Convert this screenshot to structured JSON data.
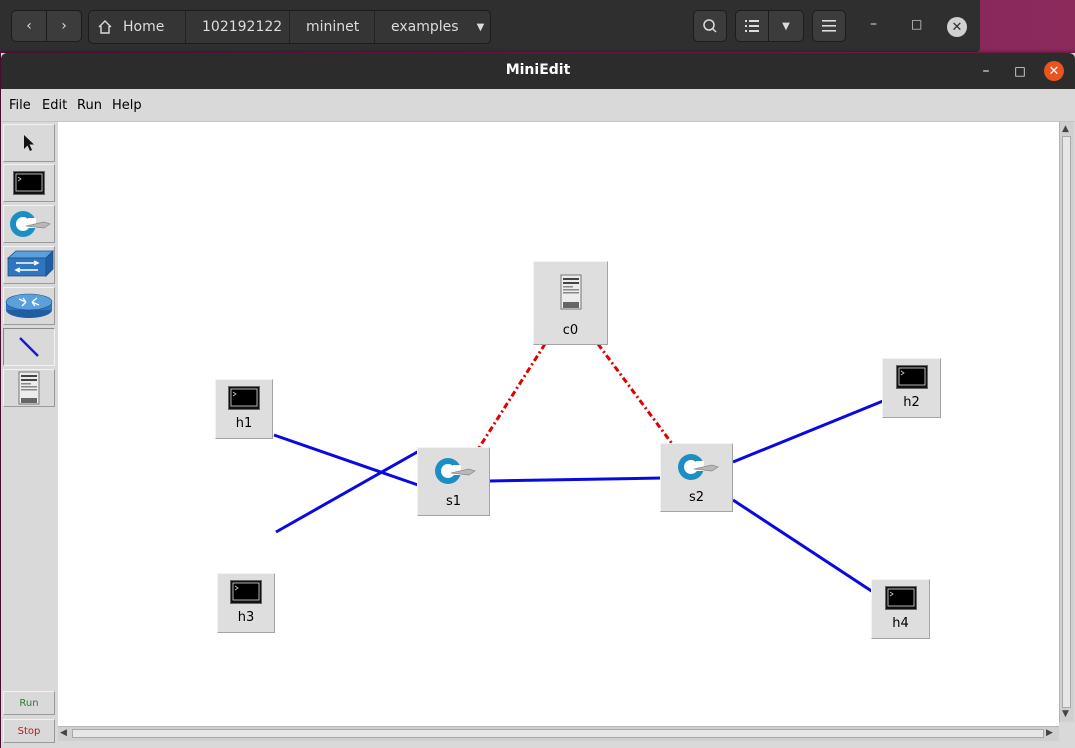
{
  "file_manager": {
    "breadcrumbs": [
      "Home",
      "102192122",
      "mininet",
      "examples"
    ]
  },
  "window": {
    "title": "MiniEdit",
    "menu": [
      "File",
      "Edit",
      "Run",
      "Help"
    ]
  },
  "toolbar": {
    "tools": [
      "select-tool",
      "host-tool",
      "switch-tool",
      "legacy-switch-tool",
      "legacy-router-tool",
      "netlink-tool",
      "controller-tool"
    ],
    "run_label": "Run",
    "stop_label": "Stop",
    "run_color": "#2e7d32",
    "stop_color": "#b71c1c"
  },
  "topology": {
    "nodes": [
      {
        "id": "c0",
        "label": "c0",
        "type": "controller"
      },
      {
        "id": "h1",
        "label": "h1",
        "type": "host"
      },
      {
        "id": "h2",
        "label": "h2",
        "type": "host"
      },
      {
        "id": "h3",
        "label": "h3",
        "type": "host"
      },
      {
        "id": "h4",
        "label": "h4",
        "type": "host"
      },
      {
        "id": "s1",
        "label": "s1",
        "type": "switch"
      },
      {
        "id": "s2",
        "label": "s2",
        "type": "switch"
      }
    ],
    "links": [
      {
        "from": "h1",
        "to": "s1",
        "kind": "data"
      },
      {
        "from": "h3",
        "to": "s1",
        "kind": "data"
      },
      {
        "from": "s1",
        "to": "s2",
        "kind": "data"
      },
      {
        "from": "s2",
        "to": "h2",
        "kind": "data"
      },
      {
        "from": "s2",
        "to": "h4",
        "kind": "data"
      },
      {
        "from": "c0",
        "to": "s1",
        "kind": "control"
      },
      {
        "from": "c0",
        "to": "s2",
        "kind": "control"
      }
    ],
    "data_link_color": "#0000e0",
    "control_link_color": "#e00000"
  }
}
